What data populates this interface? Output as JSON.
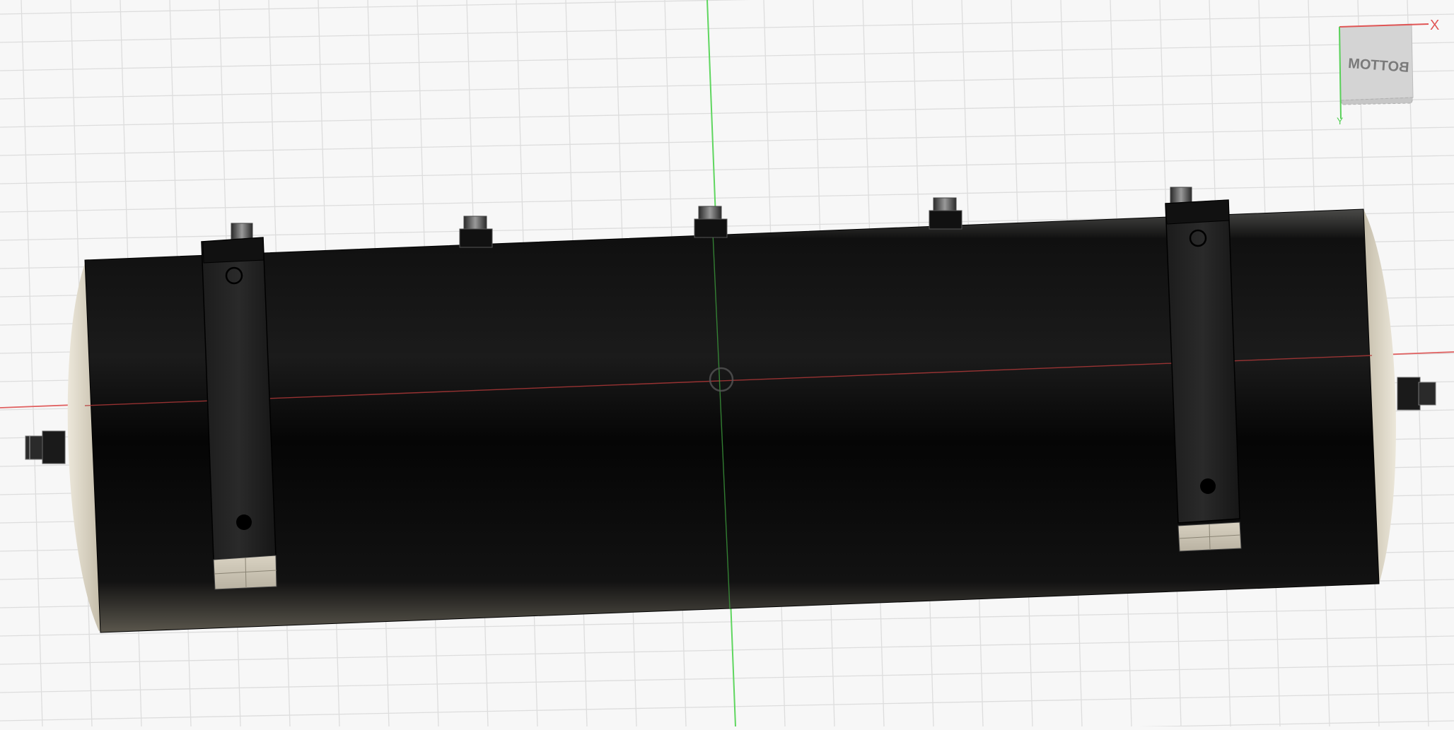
{
  "viewport": {
    "background": "#f7f7f7",
    "grid_color": "#dcdcdc",
    "x_axis_color": "#e05555",
    "y_axis_color": "#58d058",
    "model_color": "#0b0b0b",
    "end_cap_color": "#e6e0d2"
  },
  "viewcube": {
    "face_label": "BOTTOM",
    "x_label": "X",
    "y_label": "Y"
  }
}
